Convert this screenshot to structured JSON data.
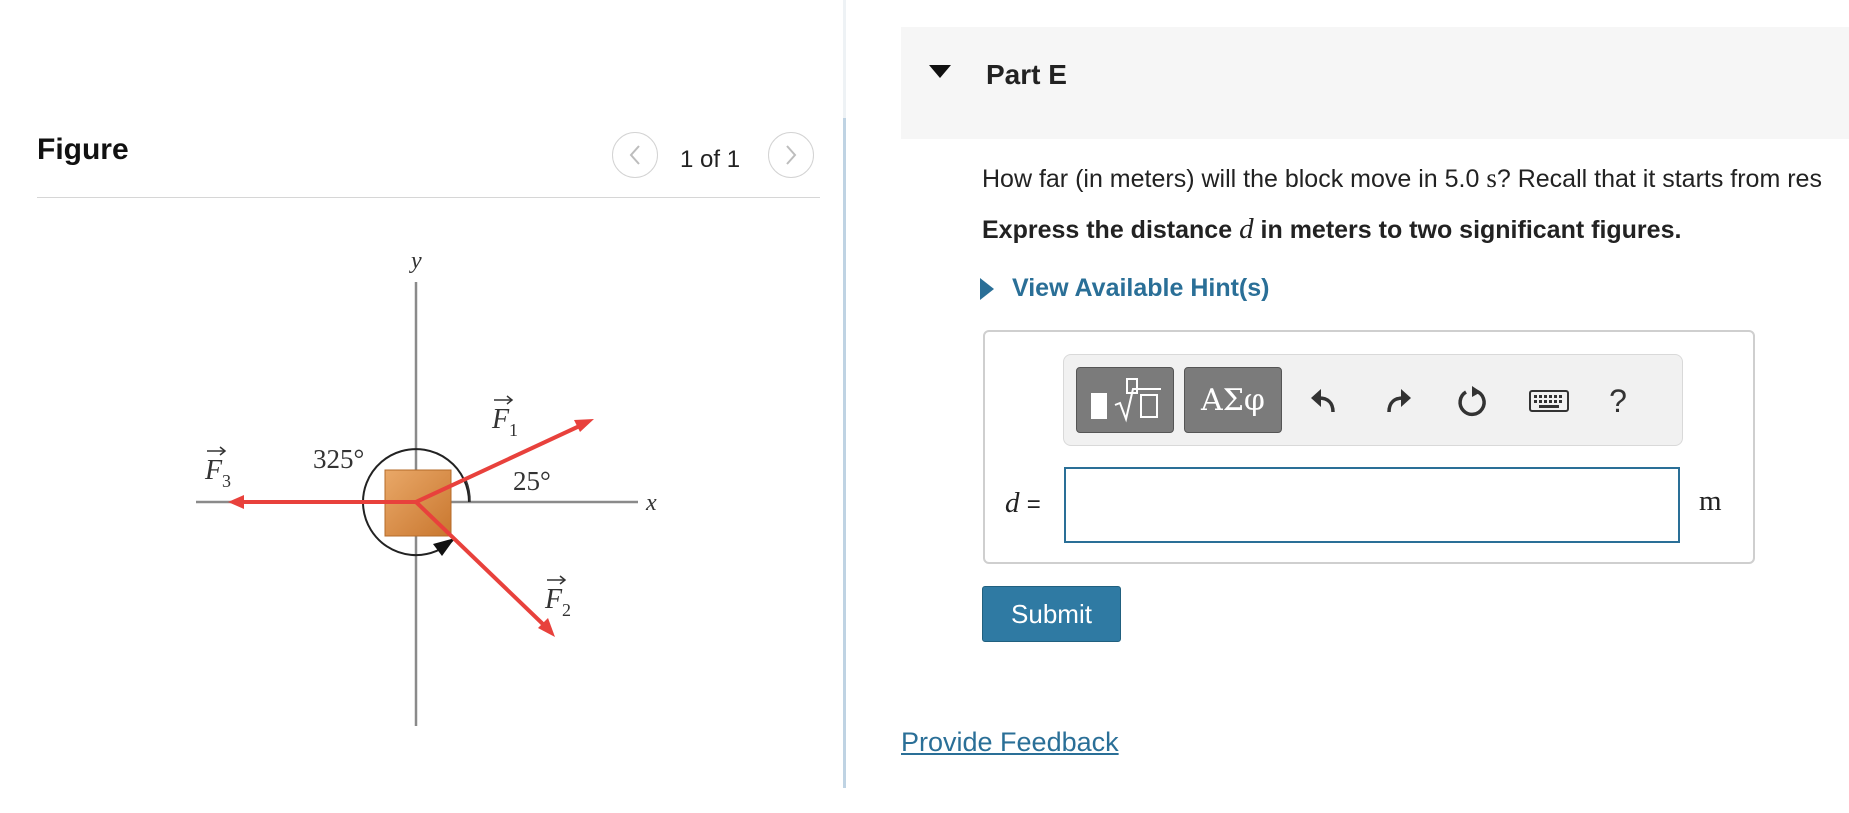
{
  "figure_panel": {
    "title": "Figure",
    "pagination": "1 of 1",
    "diagram": {
      "axis_x_label": "x",
      "axis_y_label": "y",
      "angle_f1": "25°",
      "angle_f3": "325°",
      "force_labels": [
        "F",
        "F",
        "F"
      ],
      "force_subscripts": [
        "1",
        "2",
        "3"
      ],
      "force_color": "#e8413c",
      "block_color": "#d98a3f"
    }
  },
  "question_panel": {
    "part_title": "Part E",
    "question_prefix": "How far (in meters) will the block move in 5.0",
    "question_unit": "s",
    "question_suffix": "? Recall that it starts from res",
    "instruction_prefix": "Express the distance",
    "instruction_var": "d",
    "instruction_suffix": "in meters to two significant figures.",
    "hints_label": "View Available Hint(s)",
    "toolbar": {
      "greek_label": "ΑΣφ",
      "help_label": "?"
    },
    "answer": {
      "variable": "d",
      "equals": "=",
      "value": "",
      "unit": "m"
    },
    "submit_label": "Submit",
    "feedback_label": "Provide Feedback"
  },
  "colors": {
    "link": "#2a6f97",
    "submit": "#2f7aa3",
    "toolbar_button": "#7b7b7b"
  }
}
